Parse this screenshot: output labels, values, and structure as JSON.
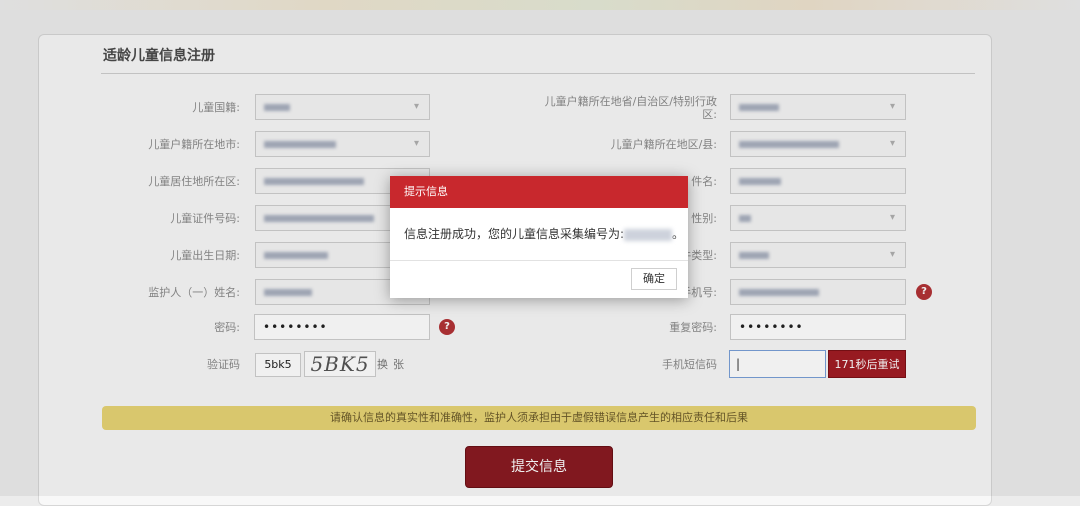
{
  "page": {
    "title": "适龄儿童信息注册",
    "notice": "请确认信息的真实性和准确性，监护人须承担由于虚假错误信息产生的相应责任和后果",
    "submit_label": "提交信息"
  },
  "form": {
    "left": {
      "nationality_label": "儿童国籍:",
      "city_label": "儿童户籍所在地市:",
      "residence_label": "儿童居住地所在区:",
      "id_number_label": "儿童证件号码:",
      "birthdate_label": "儿童出生日期:",
      "guardian_label": "监护人（一）姓名:",
      "password_label": "密码:",
      "password_value": "••••••••",
      "captcha_label": "验证码",
      "captcha_input_value": "5bk5",
      "captcha_image_text": "5BK5",
      "captcha_change_label": "换张"
    },
    "right": {
      "province_label": "儿童户籍所在地省/自治区/特别行政区:",
      "district_label": "儿童户籍所在地区/县:",
      "name_label_partial": "件名:",
      "gender_label_partial": "性别:",
      "type_label_partial": "件类型:",
      "phone_label_partial": "手机号:",
      "confirm_password_label": "重复密码:",
      "confirm_password_value": "••••••••",
      "sms_label": "手机短信码",
      "sms_input_value": "|",
      "sms_button_label": "171秒后重试"
    },
    "help_icon_glyph": "?"
  },
  "modal": {
    "title": "提示信息",
    "message": "信息注册成功，您的儿童信息采集编号为:",
    "message_end": "。",
    "ok_label": "确定"
  },
  "colors": {
    "accent_red": "#c8282d",
    "button_dark_red": "#8a1a21",
    "notice_yellow": "#e7d474"
  },
  "icons": {
    "help": "question-circle-icon",
    "dropdown": "chevron-down-icon"
  }
}
